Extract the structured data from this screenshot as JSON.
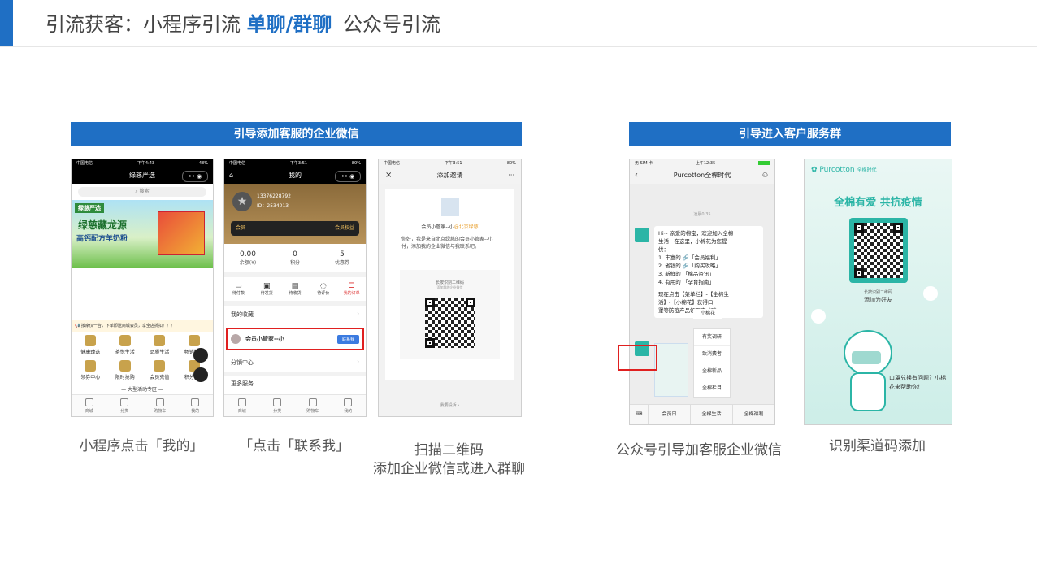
{
  "header": {
    "title_part1": "引流获客：小程序引流",
    "title_highlight": "单聊/群聊",
    "title_part3": "公众号引流"
  },
  "sections": {
    "left_banner": "引导添加客服的企业微信",
    "right_banner": "引导进入客户服务群"
  },
  "phone1": {
    "status_left": "中国电信",
    "status_time": "下午4:43",
    "status_right": "48%",
    "nav_title": "绿慈严选",
    "search": "搜索",
    "hero_brand": "绿慈严选",
    "hero_line1": "绿慈藏龙源",
    "hero_line2": "高钙配方羊奶粉",
    "notice": "按摩仪一台，下单即送商城会员，享全店折扣！！！",
    "icons": [
      "健康臻选",
      "茶悦生活",
      "品质生活",
      "畅销精品",
      "领券中心",
      "限时抢购",
      "会员充值",
      "积分兑换"
    ],
    "promo": "— 大型活动专区 —",
    "tabs": [
      "商城",
      "分类",
      "购物车",
      "我的"
    ]
  },
  "phone2": {
    "status_left": "中国电信",
    "status_time": "下午3:51",
    "status_right": "80%",
    "nav_title": "我的",
    "phone_number": "13376228792",
    "member_id": "ID：2534013",
    "member_label": "会员",
    "member_rights": "会员权益",
    "stats": [
      {
        "value": "0.00",
        "label": "余额(¥)"
      },
      {
        "value": "0",
        "label": "积分"
      },
      {
        "value": "5",
        "label": "优惠券"
      }
    ],
    "orders": [
      "待付款",
      "待发货",
      "待收货",
      "待评价",
      "我的订单"
    ],
    "menu_collect": "我的收藏",
    "contact_name": "会员小管家--小",
    "contact_button": "联系我",
    "menu_distribution": "分销中心",
    "menu_more": "更多服务",
    "tabs": [
      "商城",
      "分类",
      "购物车",
      "我的"
    ]
  },
  "phone3": {
    "status_left": "中国电信",
    "status_time": "下午3:51",
    "status_right": "80%",
    "nav_title": "添加邀请",
    "inviter": "会员小管家--小",
    "inviter_org": "@北京绿慈",
    "message": "你好，我是来自北京绿慈的会员小管家--小付，添加我的企业微信与我联系吧。",
    "qr_hint1": "长按识别二维码",
    "qr_hint2": "添加我的企业微信",
    "report": "我要投诉"
  },
  "phone4": {
    "status_left": "无 SIM 卡",
    "status_time": "上午12:35",
    "nav_title": "Purcotton全棉时代",
    "time_divider": "凌晨0:35",
    "msg_lines": [
      "Hi~ 亲爱的棉宝，欢迎加入全棉",
      "生活！在这里，小棉花为您提",
      "供：",
      "1. 丰富的 🔗「会员福利」",
      "2. 省钱的 🔗「购买攻略」",
      "3. 新鲜的 「棉品资讯」",
      "4. 有用的 「孕育指南」",
      "",
      "现在点击【菜单栏】-【全棉生",
      "活】-【小棉花】获得口",
      "罩等防疫产品领取方式哦~"
    ],
    "popup_title": "小棉花",
    "menu_items": [
      "有奖调研",
      "致消费者",
      "全棉新品",
      "全棉栏目"
    ],
    "bottom_menu": [
      "会员日",
      "全棉生活",
      "全棉福利"
    ]
  },
  "poster": {
    "brand": "Purcotton",
    "brand_cn": "全棉时代",
    "slogan": "全棉有爱  共抗疫情",
    "qr_hint1": "长按识别二维码",
    "qr_hint2": "添加为好友",
    "bubble": "口罩兑换有问题？小棉花来帮助你！"
  },
  "captions": {
    "c1": "小程序点击「我的」",
    "c2": "「点击「联系我」",
    "c3_line1": "扫描二维码",
    "c3_line2": "添加企业微信或进入群聊",
    "c4": "公众号引导加客服企业微信",
    "c5": "识别渠道码添加"
  },
  "colors": {
    "accent": "#1f6fc4",
    "highlight_box": "#e02020",
    "poster_teal": "#2bb5a6"
  }
}
